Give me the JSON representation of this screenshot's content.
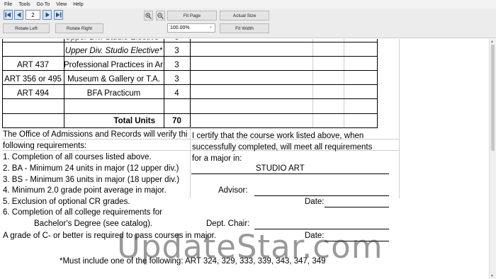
{
  "menu": [
    "File",
    "Tools",
    "Go To",
    "View",
    "Help"
  ],
  "toolbar": {
    "page_number": "2",
    "fit_page": "Fit Page",
    "actual_size": "Actual Size",
    "rotate_left": "Rotate Left",
    "rotate_right": "Rotate Right",
    "zoom_value": "100.00%",
    "fit_width": "Fit Width"
  },
  "document": {
    "rows": [
      {
        "course": "",
        "description": "Upper Div. Studio Elective*",
        "units": "3"
      },
      {
        "course": "ART 437",
        "description": "Professional Practices in Ar",
        "units": "3"
      },
      {
        "course": "ART 356 or 495",
        "description": "Museum & Gallery or T.A.",
        "units": "3"
      },
      {
        "course": "ART 494",
        "description": "BFA Practicum",
        "units": "4"
      }
    ],
    "total_label": "Total Units",
    "total_value": "70",
    "left_notes": [
      "The Office of Admissions and Records will verify thi",
      "following requirements:",
      "1.  Completion of all courses listed above.",
      "2.  BA - Minimum 24 units in major (12 upper div.)",
      "3.  BS - Minimum 36 units in major (18 upper div.)",
      "4.  Minimum 2.0 grade point average in major.",
      "5.  Exclusion of optional CR grades.",
      "6.  Completion of all college requirements for",
      "Bachelor's Degree (see catalog).",
      "A grade of C- or better is required to pass courses in major."
    ],
    "right_notes": [
      "I certify that the course work listed above, when",
      "successfully completed, will meet all requirements",
      "for a major in:"
    ],
    "major": "STUDIO ART",
    "advisor_label": "Advisor:",
    "date_label": "Date:",
    "dept_chair_label": "Dept. Chair:",
    "date_label_2": "Date:",
    "footnote": "*Must include one of the following: ART 324, 329, 333, 339, 343, 347, 349"
  },
  "watermark": "UpdateStar.com"
}
